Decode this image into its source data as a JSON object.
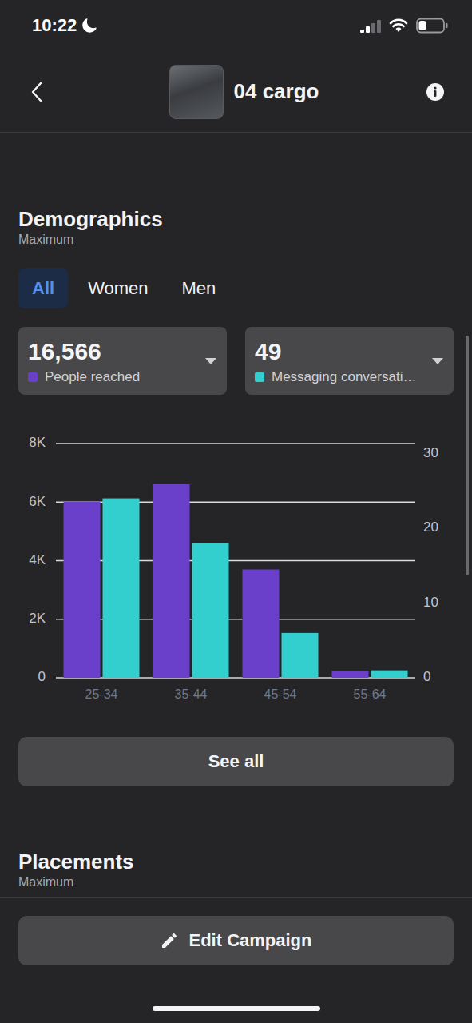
{
  "status_bar": {
    "time": "10:22",
    "signal_level": 0.5,
    "battery_level": 0.3
  },
  "header": {
    "title": "04 cargo"
  },
  "demographics": {
    "title": "Demographics",
    "subtitle": "Maximum",
    "tabs": [
      {
        "label": "All",
        "selected": true
      },
      {
        "label": "Women",
        "selected": false
      },
      {
        "label": "Men",
        "selected": false
      }
    ],
    "metrics": [
      {
        "value": "16,566",
        "label": "People reached",
        "color": "#6a3fc9"
      },
      {
        "value": "49",
        "label": "Messaging conversati…",
        "color": "#33cfcf"
      }
    ],
    "chart": {
      "categories": [
        "25-34",
        "35-44",
        "45-54",
        "55-64"
      ],
      "left_ticks": [
        "8K",
        "6K",
        "4K",
        "2K",
        "0"
      ],
      "right_ticks": [
        "30",
        "20",
        "10",
        "0"
      ],
      "series": [
        {
          "axis": "left",
          "color": "#6a3fc9",
          "values": [
            6010,
            6610,
            3700,
            246
          ]
        },
        {
          "axis": "right",
          "color": "#33cfcf",
          "values": [
            24,
            18,
            6,
            1
          ]
        }
      ]
    },
    "see_all": "See all"
  },
  "placements": {
    "title": "Placements",
    "subtitle": "Maximum"
  },
  "edit_button": "Edit Campaign"
}
